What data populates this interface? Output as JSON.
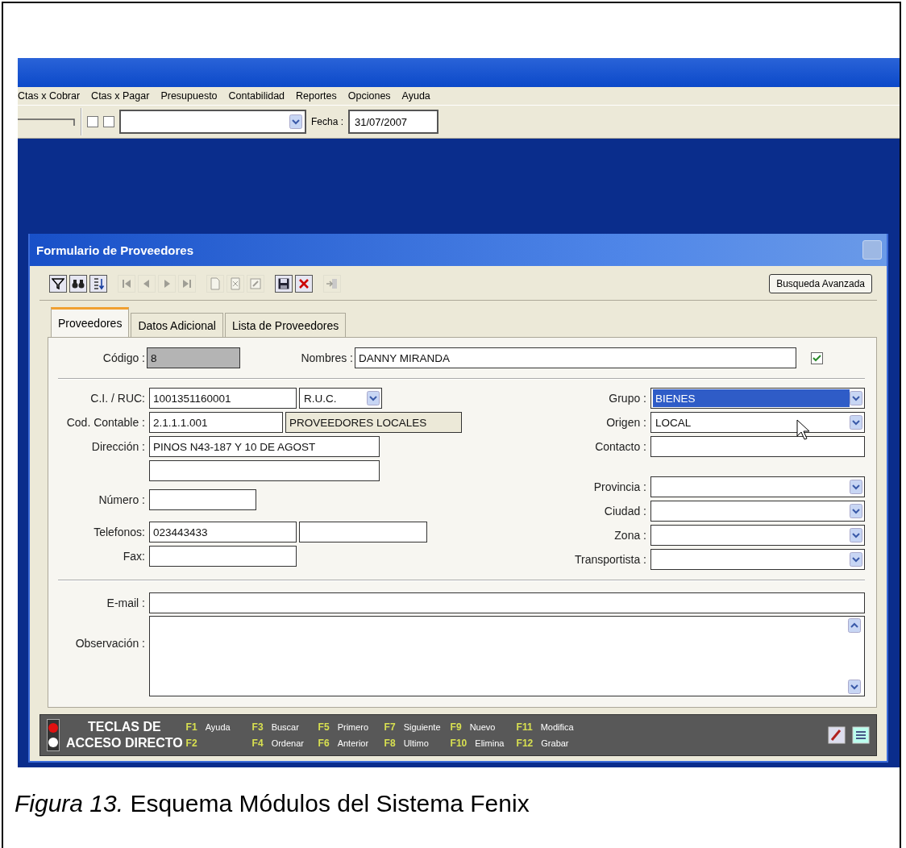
{
  "menu": [
    {
      "label": "Ctas x Cobrar"
    },
    {
      "label": "Ctas x Pagar"
    },
    {
      "label": "Presupuesto"
    },
    {
      "label": "Contabilidad"
    },
    {
      "label": "Reportes"
    },
    {
      "label": "Opciones"
    },
    {
      "label": "Ayuda"
    }
  ],
  "toolbar": {
    "checkboxes": [
      {
        "checked": false
      },
      {
        "checked": false
      }
    ],
    "date_label": "Fecha :",
    "date": "31/07/2007"
  },
  "dialog": {
    "title": "Formulario de Proveedores",
    "tools": [
      {
        "kind": "filter",
        "disabled": false
      },
      {
        "kind": "find",
        "disabled": false
      },
      {
        "kind": "sort",
        "disabled": false
      },
      {
        "kind": "first",
        "disabled": true
      },
      {
        "kind": "prev",
        "disabled": true
      },
      {
        "kind": "next",
        "disabled": true
      },
      {
        "kind": "last",
        "disabled": true
      },
      {
        "kind": "new",
        "disabled": true
      },
      {
        "kind": "remove",
        "disabled": true
      },
      {
        "kind": "edit",
        "disabled": true
      },
      {
        "kind": "save",
        "disabled": false
      },
      {
        "kind": "cancel",
        "disabled": false
      },
      {
        "kind": "exit",
        "disabled": true
      }
    ],
    "search_button": "Busqueda Avanzada",
    "tabs": [
      {
        "label": "Proveedores",
        "selected": true
      },
      {
        "label": "Datos Adicional",
        "selected": false
      },
      {
        "label": "Lista de Proveedores",
        "selected": false
      }
    ],
    "header": {
      "code_label": "Código :",
      "code": "8",
      "name_label": "Nombres :",
      "name": "DANNY MIRANDA",
      "checked": true
    },
    "left_fields": [
      {
        "label": "C.I. / RUC:",
        "inputs": [
          {
            "kind": "text",
            "value": "1001351160001"
          },
          {
            "kind": "select",
            "value": "R.U.C."
          }
        ]
      },
      {
        "label": "Cod. Contable :",
        "inputs": [
          {
            "kind": "text",
            "value": "2.1.1.1.001"
          },
          {
            "kind": "readonly",
            "value": "PROVEEDORES LOCALES"
          }
        ]
      },
      {
        "label": "Dirección :",
        "inputs": [
          {
            "kind": "text",
            "value": "PINOS N43-187 Y 10 DE AGOST"
          }
        ]
      },
      {
        "inputs": [
          {
            "kind": "text"
          }
        ]
      },
      {
        "label": "Número :",
        "inputs": [
          {
            "kind": "text"
          }
        ]
      },
      {
        "label": "Telefonos:",
        "inputs": [
          {
            "kind": "text",
            "value": "023443433"
          },
          {
            "kind": "text"
          }
        ]
      },
      {
        "label": "Fax:",
        "inputs": [
          {
            "kind": "text"
          }
        ]
      }
    ],
    "right_fields": [
      {
        "label": "Grupo :",
        "kind": "select",
        "value": "BIENES",
        "focused": true
      },
      {
        "label": "Origen :",
        "kind": "select",
        "value": "LOCAL",
        "focused": false
      },
      {
        "label": "Contacto :",
        "kind": "text",
        "focused": false
      },
      {
        "label": "Provincia :",
        "kind": "select",
        "focused": false
      },
      {
        "label": "Ciudad :",
        "kind": "select",
        "focused": false
      },
      {
        "label": "Zona :",
        "kind": "select",
        "focused": false
      },
      {
        "label": "Transportista :",
        "kind": "select",
        "focused": false
      }
    ],
    "email_label": "E-mail :",
    "notes_label": "Observación :",
    "shortcuts": {
      "title_1": "TECLAS DE",
      "title_2": "ACCESO DIRECTO",
      "keys": [
        {
          "key": "F1",
          "action": "Ayuda"
        },
        {
          "key": "F2"
        },
        {
          "key": "F3",
          "action": "Buscar"
        },
        {
          "key": "F4",
          "action": "Ordenar"
        },
        {
          "key": "F5",
          "action": "Primero"
        },
        {
          "key": "F6",
          "action": "Anterior"
        },
        {
          "key": "F7",
          "action": "Siguiente"
        },
        {
          "key": "F8",
          "action": "Ultimo"
        },
        {
          "key": "F9",
          "action": "Nuevo"
        },
        {
          "key": "F10",
          "action": "Elimina"
        },
        {
          "key": "F11",
          "action": "Modifica"
        },
        {
          "key": "F12",
          "action": "Grabar"
        }
      ]
    }
  },
  "caption": "*Figura 13.* Esquema Módulos del Sistema Fenix"
}
